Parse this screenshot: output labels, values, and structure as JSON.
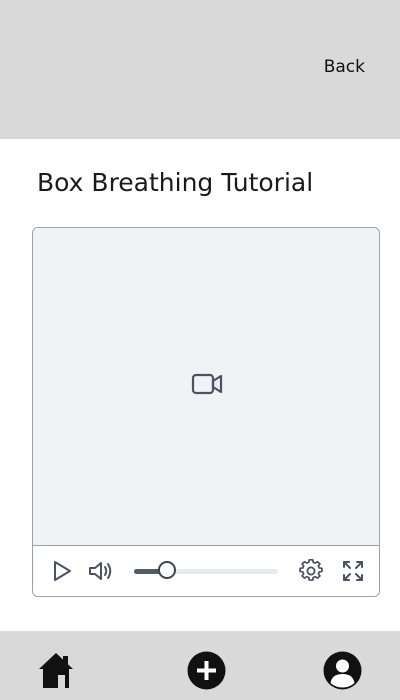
{
  "header": {
    "back_label": "Back"
  },
  "page": {
    "title": "Box Breathing Tutorial"
  },
  "player": {
    "state": "paused",
    "progress_fraction": 0.23,
    "icons": {
      "placeholder": "video-camera-icon",
      "play": "play-icon",
      "volume": "volume-icon",
      "settings": "gear-icon",
      "fullscreen": "fullscreen-icon"
    }
  },
  "bottom_nav": {
    "items": [
      {
        "id": "home",
        "icon": "home-icon"
      },
      {
        "id": "add",
        "icon": "plus-circle-icon"
      },
      {
        "id": "profile",
        "icon": "user-circle-icon"
      }
    ]
  },
  "colors": {
    "header_bg": "#d9d9d9",
    "video_bg": "#f1f2f6",
    "icon": "#4a5363",
    "nav_icon": "#111111"
  }
}
